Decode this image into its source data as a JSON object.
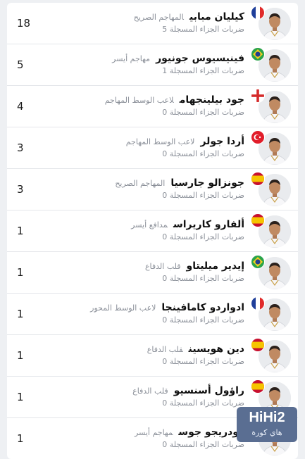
{
  "stat_label": "ضربات الجزاء المسجلة",
  "players": [
    {
      "name": "كيليان مبابي",
      "position": "المهاجم الصريح",
      "penalties": "5",
      "count": "18",
      "flag": "france",
      "flag_icon": "france-flag-icon"
    },
    {
      "name": "فينيسيوس جونيور",
      "position": "مهاجم أيسر",
      "penalties": "1",
      "count": "5",
      "flag": "brazil",
      "flag_icon": "brazil-flag-icon"
    },
    {
      "name": "جود بيلينجهام",
      "position": "لاعب الوسط المهاجم",
      "penalties": "0",
      "count": "4",
      "flag": "england",
      "flag_icon": "england-flag-icon"
    },
    {
      "name": "أردا جولر",
      "position": "لاعب الوسط المهاجم",
      "penalties": "0",
      "count": "3",
      "flag": "turkey",
      "flag_icon": "turkey-flag-icon"
    },
    {
      "name": "جونزالو جارسيا",
      "position": "المهاجم الصريح",
      "penalties": "0",
      "count": "3",
      "flag": "spain",
      "flag_icon": "spain-flag-icon"
    },
    {
      "name": "ألفارو كاريراس",
      "position": "مدافع أيسر",
      "penalties": "0",
      "count": "1",
      "flag": "spain",
      "flag_icon": "spain-flag-icon"
    },
    {
      "name": "إيدير ميليتاو",
      "position": "قلب الدفاع",
      "penalties": "0",
      "count": "1",
      "flag": "brazil",
      "flag_icon": "brazil-flag-icon"
    },
    {
      "name": "ادواردو كامافينجا",
      "position": "لاعب الوسط المحور",
      "penalties": "0",
      "count": "1",
      "flag": "france",
      "flag_icon": "france-flag-icon"
    },
    {
      "name": "دين هويسين",
      "position": "قلب الدفاع",
      "penalties": "0",
      "count": "1",
      "flag": "spain",
      "flag_icon": "spain-flag-icon"
    },
    {
      "name": "راؤول أسنسيو",
      "position": "قلب الدفاع",
      "penalties": "0",
      "count": "1",
      "flag": "spain",
      "flag_icon": "spain-flag-icon"
    },
    {
      "name": "رودريجو جوس",
      "position": "مهاجم أيسر",
      "penalties": "0",
      "count": "1",
      "flag": "brazil",
      "flag_icon": "brazil-flag-icon"
    }
  ],
  "watermark": {
    "main": "HiHi2",
    "sub": "هاي كورة"
  },
  "colors": {
    "background": "#eef0f3",
    "card": "#ffffff",
    "muted": "#8a8f98",
    "logo": "#5a6e92"
  }
}
